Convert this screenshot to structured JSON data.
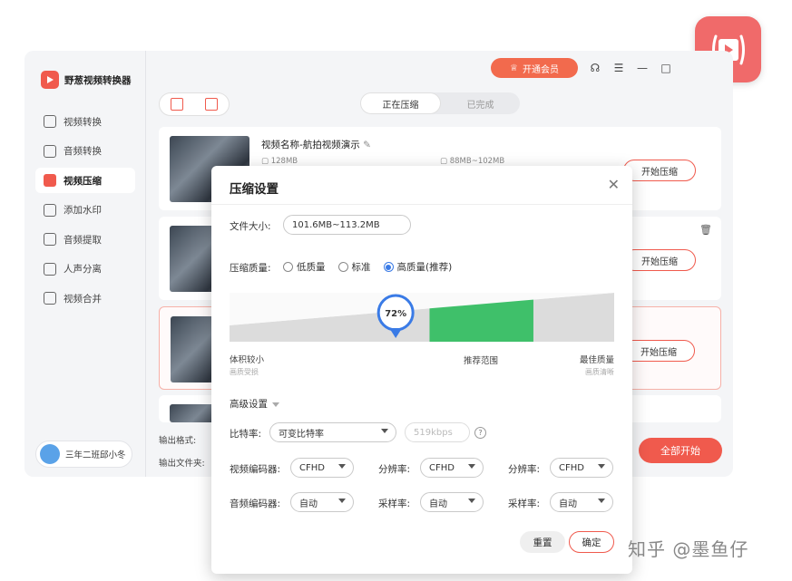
{
  "app": {
    "name": "野葱视频转换器",
    "vip_button": "开通会员",
    "user_name": "三年二班邱小冬"
  },
  "sidebar": {
    "items": [
      {
        "label": "视频转换",
        "icon": "video-convert-icon"
      },
      {
        "label": "音频转换",
        "icon": "audio-convert-icon"
      },
      {
        "label": "视频压缩",
        "icon": "video-compress-icon",
        "active": true
      },
      {
        "label": "添加水印",
        "icon": "watermark-icon"
      },
      {
        "label": "音频提取",
        "icon": "audio-extract-icon"
      },
      {
        "label": "人声分离",
        "icon": "vocal-separate-icon"
      },
      {
        "label": "视频合并",
        "icon": "video-merge-icon"
      }
    ]
  },
  "tabs": {
    "compressing": "正在压缩",
    "done": "已完成"
  },
  "file_card": {
    "name": "视频名称-航拍视频演示",
    "original_size": "128MB",
    "target_size": "88MB~102MB"
  },
  "card_button": "开始压缩",
  "bottom": {
    "output_format_label": "输出格式:",
    "output_folder_label": "输出文件夹:",
    "start_all": "全部开始"
  },
  "dialog": {
    "title": "压缩设置",
    "file_size_label": "文件大小:",
    "file_size_value": "101.6MB~113.2MB",
    "quality_label": "压缩质量:",
    "quality_options": [
      "低质量",
      "标准",
      "高质量(推荐)"
    ],
    "quality_selected": 2,
    "slider": {
      "percent": "72%",
      "value": 0.72,
      "left_label": "体积较小",
      "left_sub": "画质受损",
      "middle_label": "推荐范围",
      "right_label": "最佳质量",
      "right_sub": "画质清晰",
      "recommended_range": [
        0.52,
        0.79
      ],
      "accent": "#3fc06a"
    },
    "advanced_label": "高级设置",
    "bitrate_label": "比特率:",
    "bitrate_mode": "可变比特率",
    "bitrate_value_placeholder": "519kbps",
    "video_encoder_label": "视频编码器:",
    "video_encoder_value": "CFHD",
    "resolution_label": "分辨率:",
    "resolution_value": "CFHD",
    "resolution2_label": "分辨率:",
    "resolution2_value": "CFHD",
    "audio_encoder_label": "音频编码器:",
    "audio_encoder_value": "自动",
    "sample_rate_label": "采样率:",
    "sample_rate_value": "自动",
    "sample_rate2_label": "采样率:",
    "sample_rate2_value": "自动",
    "reset_button": "重置",
    "ok_button": "确定"
  },
  "watermark": "知乎 @墨鱼仔",
  "colors": {
    "brand": "#f05a4d",
    "radio": "#3a7be6",
    "recommended": "#3fc06a"
  }
}
